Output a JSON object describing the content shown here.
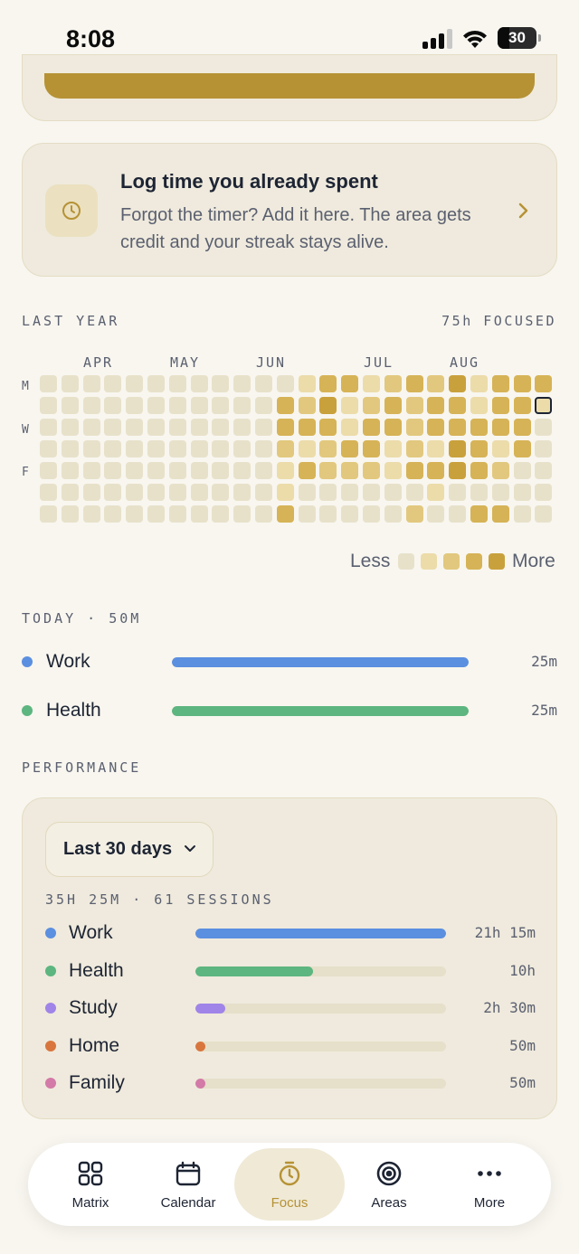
{
  "status_bar": {
    "time": "8:08",
    "battery": "30"
  },
  "log_card": {
    "title": "Log time you already spent",
    "description": "Forgot the timer? Add it here. The area gets credit and your streak stays alive.",
    "icon": "clock-icon"
  },
  "heatmap": {
    "title": "LAST YEAR",
    "total": "75h FOCUSED",
    "months": [
      "APR",
      "MAY",
      "JUN",
      "JUL",
      "AUG"
    ],
    "day_labels": [
      "M",
      "W",
      "F"
    ],
    "levels": [
      [
        0,
        0,
        0,
        0,
        0,
        0,
        0,
        0,
        0,
        0,
        0,
        0,
        1,
        3,
        3,
        1,
        2,
        3,
        2,
        4,
        1,
        3,
        3,
        3
      ],
      [
        0,
        0,
        0,
        0,
        0,
        0,
        0,
        0,
        0,
        0,
        0,
        3,
        2,
        4,
        1,
        2,
        3,
        2,
        3,
        3,
        1,
        3,
        3,
        1
      ],
      [
        0,
        0,
        0,
        0,
        0,
        0,
        0,
        0,
        0,
        0,
        0,
        3,
        3,
        3,
        1,
        3,
        3,
        2,
        3,
        3,
        3,
        3,
        3,
        0
      ],
      [
        0,
        0,
        0,
        0,
        0,
        0,
        0,
        0,
        0,
        0,
        0,
        2,
        1,
        2,
        3,
        3,
        1,
        2,
        1,
        4,
        3,
        1,
        3,
        0
      ],
      [
        0,
        0,
        0,
        0,
        0,
        0,
        0,
        0,
        0,
        0,
        0,
        1,
        3,
        2,
        2,
        2,
        1,
        3,
        3,
        4,
        3,
        2,
        0,
        0
      ],
      [
        0,
        0,
        0,
        0,
        0,
        0,
        0,
        0,
        0,
        0,
        0,
        1,
        0,
        0,
        0,
        0,
        0,
        0,
        1,
        0,
        0,
        0,
        0,
        0
      ],
      [
        0,
        0,
        0,
        0,
        0,
        0,
        0,
        0,
        0,
        0,
        0,
        3,
        0,
        0,
        0,
        0,
        0,
        2,
        0,
        0,
        3,
        3,
        0,
        0
      ]
    ],
    "today_cell": {
      "row": 1,
      "col": 23
    },
    "level_colors": [
      "#e8e1ca",
      "#ecdcaa",
      "#e2c87e",
      "#d6b356",
      "#c9a13c"
    ],
    "legend_less": "Less",
    "legend_more": "More"
  },
  "today": {
    "title": "TODAY · 50M",
    "rows": [
      {
        "label": "Work",
        "value": "25m",
        "fraction": 1.0,
        "color": "#5b8fe0"
      },
      {
        "label": "Health",
        "value": "25m",
        "fraction": 1.0,
        "color": "#5db57f"
      }
    ]
  },
  "performance": {
    "title": "PERFORMANCE",
    "range": "Last 30 days",
    "summary": "35H 25M · 61 SESSIONS",
    "rows": [
      {
        "label": "Work",
        "value": "21h 15m",
        "fraction": 1.0,
        "color": "#5b8fe0"
      },
      {
        "label": "Health",
        "value": "10h",
        "fraction": 0.47,
        "color": "#5db57f"
      },
      {
        "label": "Study",
        "value": "2h 30m",
        "fraction": 0.12,
        "color": "#a084e8"
      },
      {
        "label": "Home",
        "value": "50m",
        "fraction": 0.04,
        "color": "#d8763e"
      },
      {
        "label": "Family",
        "value": "50m",
        "fraction": 0.04,
        "color": "#d37aa8"
      }
    ]
  },
  "nav": {
    "items": [
      {
        "label": "Matrix",
        "icon": "grid-icon",
        "active": false
      },
      {
        "label": "Calendar",
        "icon": "calendar-icon",
        "active": false
      },
      {
        "label": "Focus",
        "icon": "stopwatch-icon",
        "active": true
      },
      {
        "label": "Areas",
        "icon": "target-icon",
        "active": false
      },
      {
        "label": "More",
        "icon": "ellipsis-icon",
        "active": false
      }
    ],
    "accent": "#b69235"
  }
}
